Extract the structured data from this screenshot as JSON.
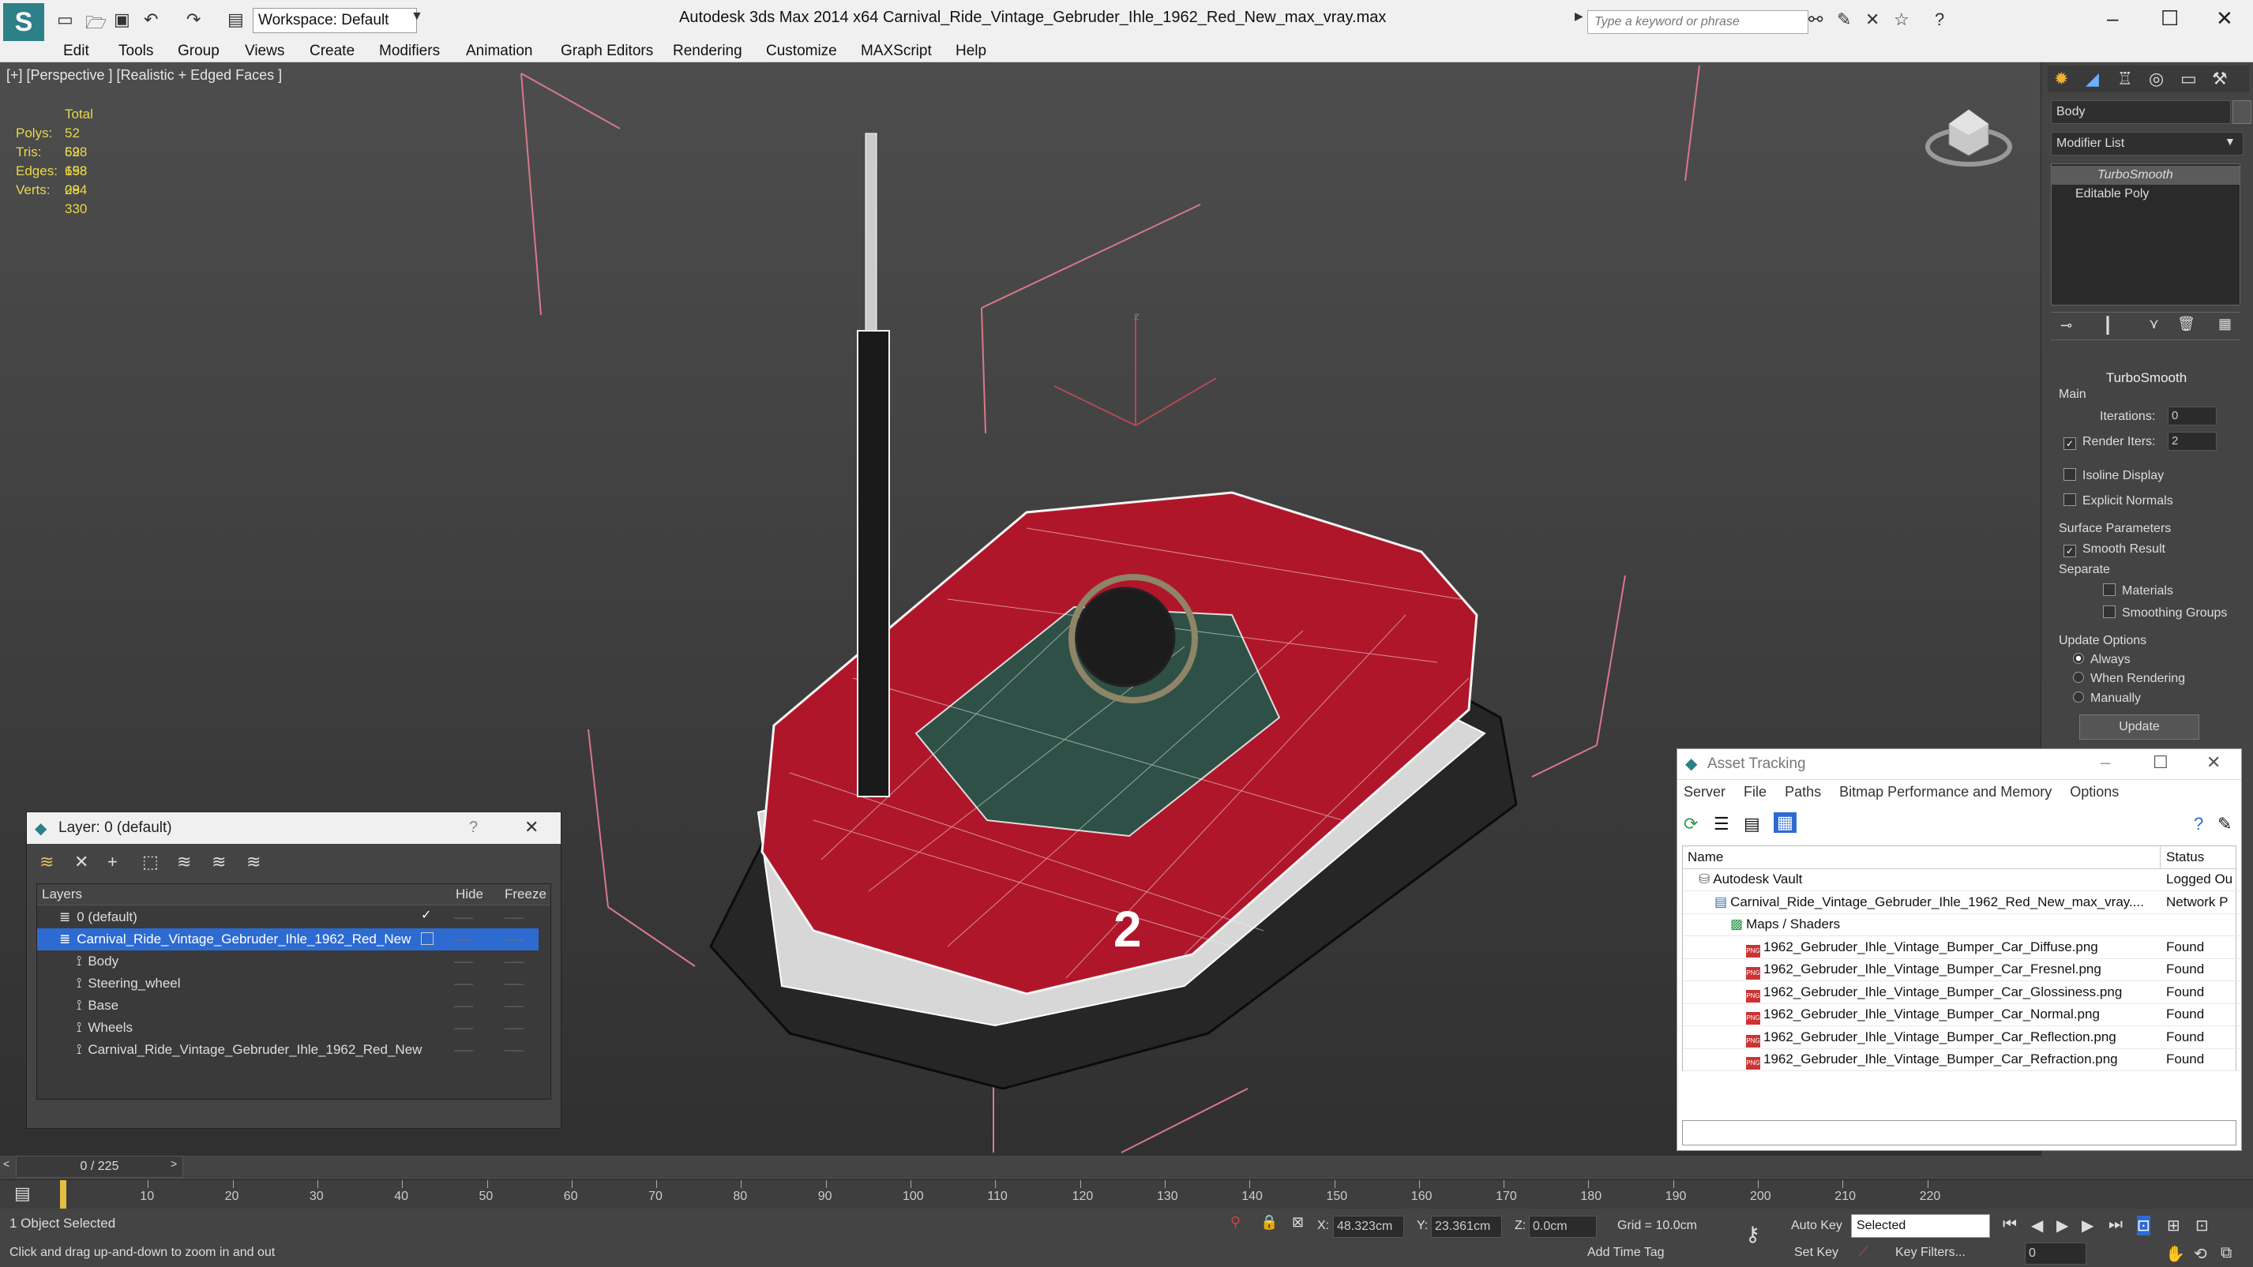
{
  "app": {
    "title": "Autodesk 3ds Max  2014 x64      Carnival_Ride_Vintage_Gebruder_Ihle_1962_Red_New_max_vray.max",
    "workspace": "Workspace: Default",
    "search_placeholder": "Type a keyword or phrase"
  },
  "menu": [
    "Edit",
    "Tools",
    "Group",
    "Views",
    "Create",
    "Modifiers",
    "Animation",
    "Graph Editors",
    "Rendering",
    "Customize",
    "MAXScript",
    "Help"
  ],
  "viewport": {
    "label": "[+] [Perspective ] [Realistic + Edged Faces ]",
    "stats": {
      "header": "Total",
      "rows": [
        {
          "label": "Polys:",
          "value": "52 698"
        },
        {
          "label": "Tris:",
          "value": "52 698"
        },
        {
          "label": "Edges:",
          "value": "158 094"
        },
        {
          "label": "Verts:",
          "value": "28 330"
        }
      ]
    },
    "car_number": "2"
  },
  "command_panel": {
    "object_name": "Body",
    "modifier_list": "Modifier List",
    "stack": [
      "TurboSmooth",
      "Editable Poly"
    ],
    "rollout_title": "TurboSmooth",
    "main_label": "Main",
    "iterations_label": "Iterations:",
    "iterations_value": "0",
    "render_iters_label": "Render Iters:",
    "render_iters_value": "2",
    "isoline_display": "Isoline Display",
    "explicit_normals": "Explicit Normals",
    "surface_params": "Surface Parameters",
    "smooth_result": "Smooth Result",
    "separate": "Separate",
    "materials": "Materials",
    "smoothing_groups": "Smoothing Groups",
    "update_options": "Update Options",
    "always": "Always",
    "when_rendering": "When Rendering",
    "manually": "Manually",
    "update_button": "Update"
  },
  "layer_dialog": {
    "title": "Layer: 0 (default)",
    "help": "?",
    "columns": {
      "layers": "Layers",
      "hide": "Hide",
      "freeze": "Freeze"
    },
    "rows": [
      {
        "name": "0 (default)",
        "indent": 1,
        "selected": false,
        "check": true
      },
      {
        "name": "Carnival_Ride_Vintage_Gebruder_Ihle_1962_Red_New",
        "indent": 1,
        "selected": true,
        "check": false
      },
      {
        "name": "Body",
        "indent": 2,
        "selected": false,
        "check": false
      },
      {
        "name": "Steering_wheel",
        "indent": 2,
        "selected": false,
        "check": false
      },
      {
        "name": "Base",
        "indent": 2,
        "selected": false,
        "check": false
      },
      {
        "name": "Wheels",
        "indent": 2,
        "selected": false,
        "check": false
      },
      {
        "name": "Carnival_Ride_Vintage_Gebruder_Ihle_1962_Red_New",
        "indent": 2,
        "selected": false,
        "check": false
      }
    ]
  },
  "asset_dialog": {
    "title": "Asset Tracking",
    "menu": [
      "Server",
      "File",
      "Paths",
      "Bitmap Performance and Memory",
      "Options"
    ],
    "columns": {
      "name": "Name",
      "status": "Status"
    },
    "rows": [
      {
        "name": "Autodesk Vault",
        "status": "Logged Ou",
        "indent": 1,
        "icon": "vault"
      },
      {
        "name": "Carnival_Ride_Vintage_Gebruder_Ihle_1962_Red_New_max_vray....",
        "status": "Network P",
        "indent": 2,
        "icon": "file"
      },
      {
        "name": "Maps / Shaders",
        "status": "",
        "indent": 3,
        "icon": "maps"
      },
      {
        "name": "1962_Gebruder_Ihle_Vintage_Bumper_Car_Diffuse.png",
        "status": "Found",
        "indent": 4,
        "icon": "png"
      },
      {
        "name": "1962_Gebruder_Ihle_Vintage_Bumper_Car_Fresnel.png",
        "status": "Found",
        "indent": 4,
        "icon": "png"
      },
      {
        "name": "1962_Gebruder_Ihle_Vintage_Bumper_Car_Glossiness.png",
        "status": "Found",
        "indent": 4,
        "icon": "png"
      },
      {
        "name": "1962_Gebruder_Ihle_Vintage_Bumper_Car_Normal.png",
        "status": "Found",
        "indent": 4,
        "icon": "png"
      },
      {
        "name": "1962_Gebruder_Ihle_Vintage_Bumper_Car_Reflection.png",
        "status": "Found",
        "indent": 4,
        "icon": "png"
      },
      {
        "name": "1962_Gebruder_Ihle_Vintage_Bumper_Car_Refraction.png",
        "status": "Found",
        "indent": 4,
        "icon": "png"
      }
    ]
  },
  "timeline": {
    "frame_display": "0 / 225",
    "ticks": [
      "10",
      "20",
      "30",
      "40",
      "50",
      "60",
      "70",
      "80",
      "90",
      "100",
      "110",
      "120",
      "130",
      "140",
      "150",
      "160",
      "170",
      "180",
      "190",
      "200",
      "210",
      "220"
    ]
  },
  "status": {
    "selection": "1 Object Selected",
    "prompt": "Click and drag up-and-down to zoom in and out",
    "x_label": "X:",
    "x_value": "48.323cm",
    "y_label": "Y:",
    "y_value": "23.361cm",
    "z_label": "Z:",
    "z_value": "0.0cm",
    "grid": "Grid = 10.0cm",
    "add_time_tag": "Add Time Tag",
    "auto_key": "Auto Key",
    "set_key": "Set Key",
    "selected_dropdown": "Selected",
    "key_filters": "Key Filters...",
    "frame_field": "0"
  },
  "colors": {
    "accent_red": "#b0162a",
    "selection_blue": "#2d6bd1",
    "stats_yellow": "#e8d84c"
  }
}
